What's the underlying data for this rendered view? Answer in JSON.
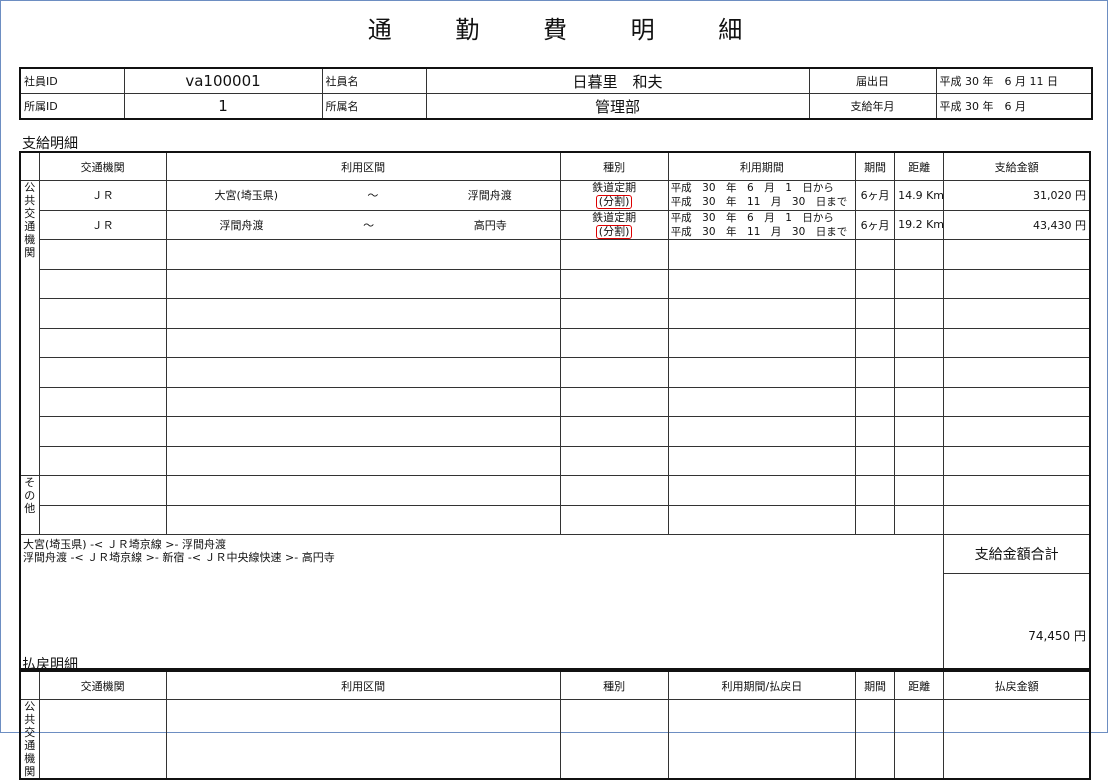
{
  "document_title": "通 勤 費 明 細",
  "header": {
    "employee_id_label": "社員ID",
    "employee_id": "va100001",
    "employee_name_label": "社員名",
    "employee_name": "日暮里　和夫",
    "filed_date_label": "届出日",
    "filed_date": "平成 30 年　6 月 11 日",
    "dept_id_label": "所属ID",
    "dept_id": "1",
    "dept_name_label": "所属名",
    "dept_name": "管理部",
    "pay_month_label": "支給年月",
    "pay_month": "平成 30 年　6 月"
  },
  "payment_section": {
    "title": "支給明細",
    "columns": [
      "交通機関",
      "利用区間",
      "種別",
      "利用期間",
      "期間",
      "距離",
      "支給金額"
    ],
    "public_transport_label": "公共交通機関",
    "other_label": "その他",
    "rows": [
      {
        "transport": "ＪＲ",
        "from": "大宮(埼玉県)",
        "tilde": "～",
        "to": "浮間舟渡",
        "kind": "鉄道定期",
        "kind_note": "(分割)",
        "period_start": "平成　30　年　6　月　1　日から",
        "period_end": "平成　30　年　11　月　30　日まで",
        "months": "6ヶ月",
        "distance": "14.9 Km",
        "amount": "31,020 円"
      },
      {
        "transport": "ＪＲ",
        "from": "浮間舟渡",
        "tilde": "～",
        "to": "高円寺",
        "kind": "鉄道定期",
        "kind_note": "(分割)",
        "period_start": "平成　30　年　6　月　1　日から",
        "period_end": "平成　30　年　11　月　30　日まで",
        "months": "6ヶ月",
        "distance": "19.2 Km",
        "amount": "43,430 円"
      }
    ],
    "route_lines": [
      "大宮(埼玉県) -< ＪＲ埼京線 >- 浮間舟渡",
      "浮間舟渡 -< ＪＲ埼京線 >- 新宿 -< ＪＲ中央線快速 >- 高円寺"
    ],
    "total_label": "支給金額合計",
    "total_value": "74,450 円"
  },
  "refund_section": {
    "title": "払戻明細",
    "columns": [
      "交通機関",
      "利用区間",
      "種別",
      "利用期間/払戻日",
      "期間",
      "距離",
      "払戻金額"
    ],
    "public_transport_label": "公共交通機関"
  }
}
